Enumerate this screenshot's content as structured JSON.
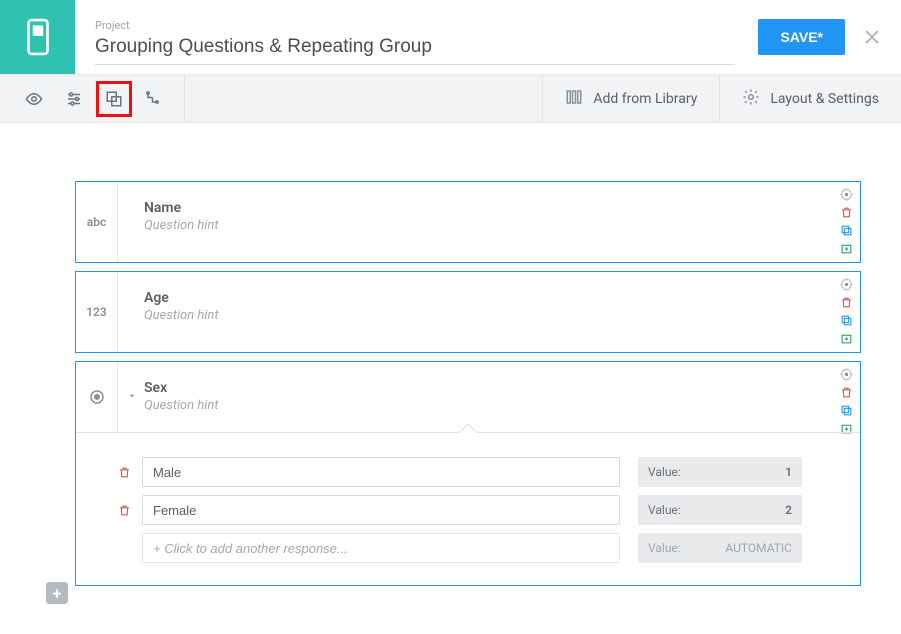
{
  "header": {
    "project_label": "Project",
    "project_title": "Grouping Questions & Repeating Group",
    "save_label": "SAVE*"
  },
  "toolbar": {
    "library_label": "Add from Library",
    "layout_label": "Layout & Settings"
  },
  "questions": [
    {
      "type_tag": "abc",
      "title": "Name",
      "hint": "Question hint"
    },
    {
      "type_tag": "123",
      "title": "Age",
      "hint": "Question hint"
    },
    {
      "type_tag_icon": "radio",
      "title": "Sex",
      "hint": "Question hint",
      "options": [
        {
          "label": "Male",
          "value_label": "Value:",
          "value": "1"
        },
        {
          "label": "Female",
          "value_label": "Value:",
          "value": "2"
        }
      ],
      "add_placeholder": "+ Click to add another response...",
      "ghost_value_label": "Value:",
      "ghost_value": "AUTOMATIC"
    }
  ]
}
